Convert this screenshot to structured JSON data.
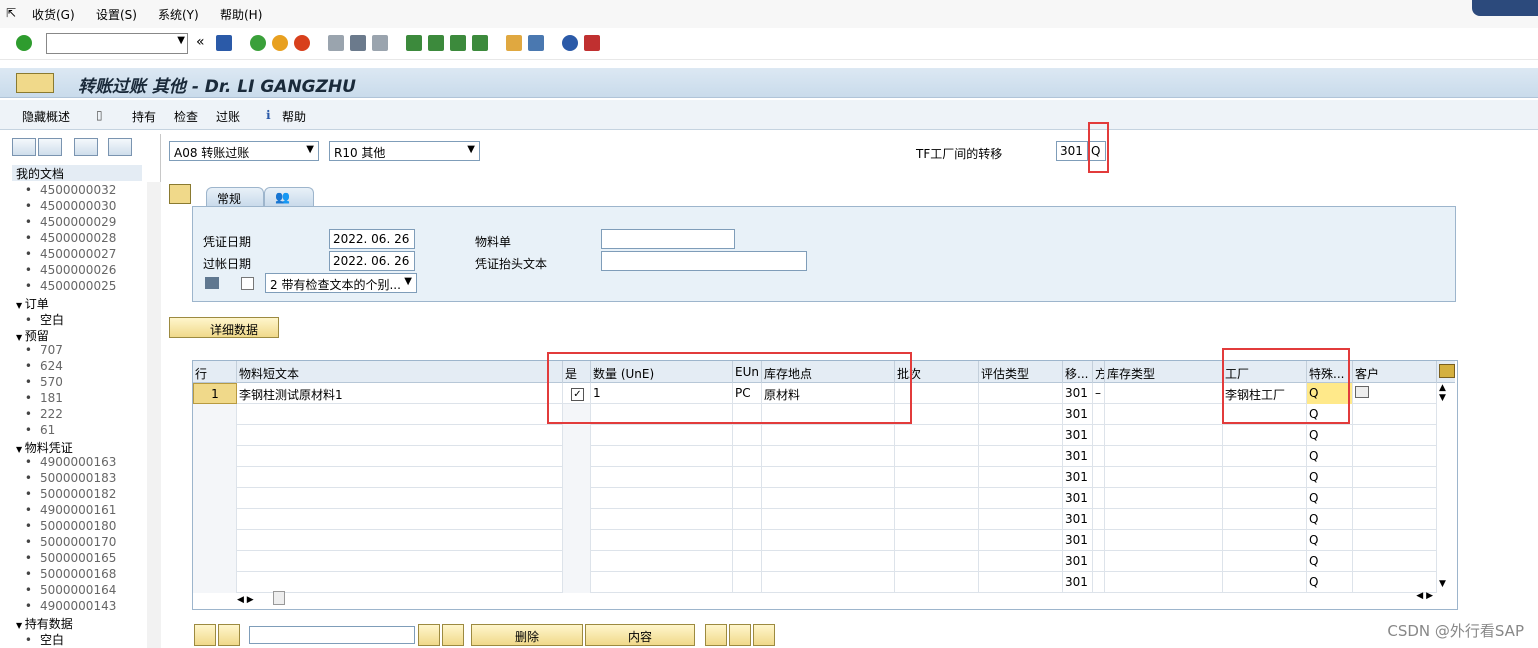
{
  "menu": [
    "收货(G)",
    "设置(S)",
    "系统(Y)",
    "帮助(H)"
  ],
  "toolbar": {
    "command_value": "",
    "arrows": "«"
  },
  "title": "转账过账 其他 - Dr. LI GANGZHU",
  "appbar": [
    "隐藏概述",
    "持有",
    "检查",
    "过账",
    "帮助"
  ],
  "tree": {
    "my_docs_label": "我的文档",
    "my_docs": [
      "4500000032",
      "4500000030",
      "4500000029",
      "4500000028",
      "4500000027",
      "4500000026",
      "4500000025"
    ],
    "orders_label": "订单",
    "orders": [
      "空白"
    ],
    "reservations_label": "预留",
    "reservations": [
      "707",
      "624",
      "570",
      "181",
      "222",
      "61"
    ],
    "matdocs_label": "物料凭证",
    "matdocs": [
      "4900000163",
      "5000000183",
      "5000000182",
      "4900000161",
      "5000000180",
      "5000000170",
      "5000000165",
      "5000000168",
      "5000000164",
      "4900000143"
    ],
    "held_label": "持有数据",
    "held": [
      "空白"
    ]
  },
  "header": {
    "action": "A08 转账过账",
    "reference": "R10 其他",
    "movement_label": "TF工厂间的转移",
    "movement_type": "301",
    "special_stock": "Q"
  },
  "tabs": {
    "general": "常规"
  },
  "general": {
    "doc_date_label": "凭证日期",
    "doc_date": "2022. 06. 26",
    "post_date_label": "过帐日期",
    "post_date": "2022. 06. 26",
    "print_option": "2 带有检查文本的个别...",
    "bill_label": "物料单",
    "bill": "",
    "header_text_label": "凭证抬头文本",
    "header_text": ""
  },
  "detail_button": "详细数据",
  "grid": {
    "headers": [
      "行",
      "物料短文本",
      "是",
      "数量 (UnE)",
      "EUn",
      "库存地点",
      "批次",
      "评估类型",
      "移...",
      "方",
      "库存类型",
      "工厂",
      "特殊...",
      "客户"
    ],
    "row1": {
      "line": "1",
      "text": "李钢柱测试原材料1",
      "checked": true,
      "qty": "1",
      "unit": "PC",
      "sloc": "原材料",
      "mvt": "301",
      "dash": "–",
      "plant": "李钢柱工厂",
      "special": "Q"
    },
    "empty_mvt": "301",
    "empty_special": "Q"
  },
  "bottom": {
    "delete": "删除",
    "content": "内容"
  },
  "watermark": "CSDN @外行看SAP"
}
